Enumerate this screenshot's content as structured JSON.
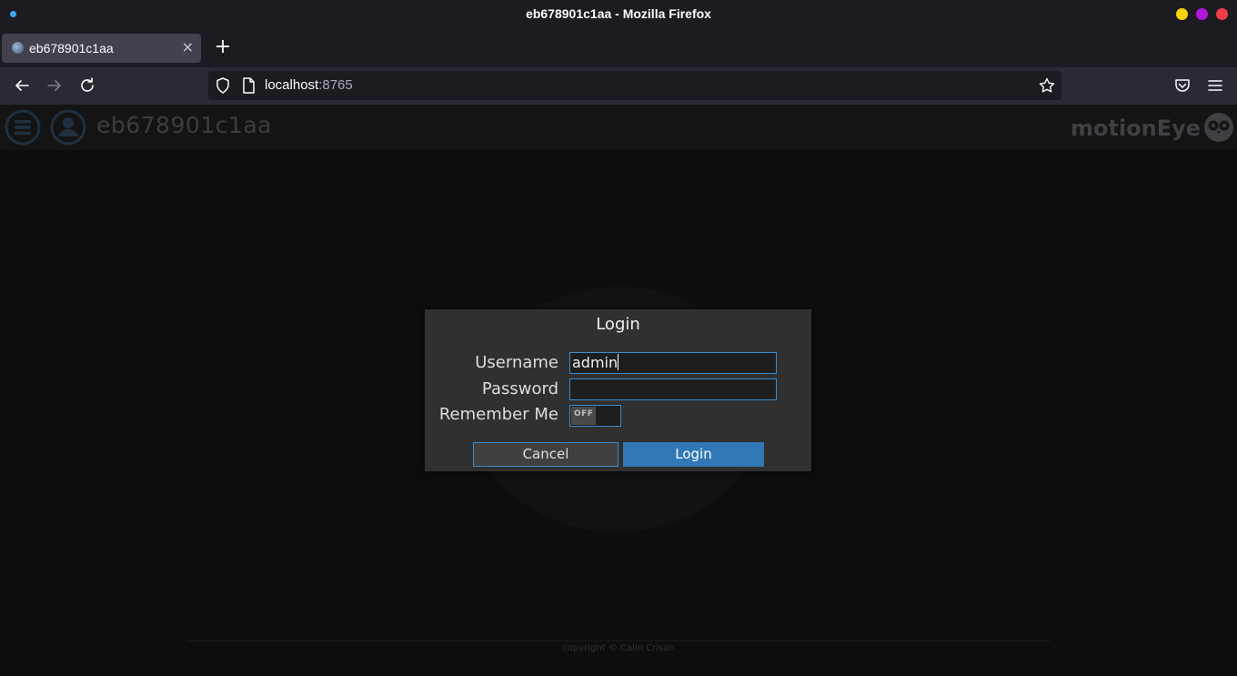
{
  "window": {
    "title": "eb678901c1aa - Mozilla Firefox"
  },
  "browser": {
    "tab_title": "eb678901c1aa",
    "tab_close": "×",
    "new_tab": "+",
    "url_host": "localhost",
    "url_port": ":8765"
  },
  "app": {
    "hostname": "eb678901c1aa",
    "brand": "motionEye",
    "copyright": "copyright © Calin Crisan"
  },
  "login_dialog": {
    "title": "Login",
    "username_label": "Username",
    "username_value": "admin",
    "password_label": "Password",
    "password_value": "",
    "remember_label": "Remember Me",
    "remember_state": "OFF",
    "cancel_label": "Cancel",
    "login_label": "Login"
  },
  "colors": {
    "accent": "#3178b6",
    "focus_border": "#3a8bd0",
    "dialog_bg": "#303030",
    "page_bg": "#0d0d0e"
  }
}
